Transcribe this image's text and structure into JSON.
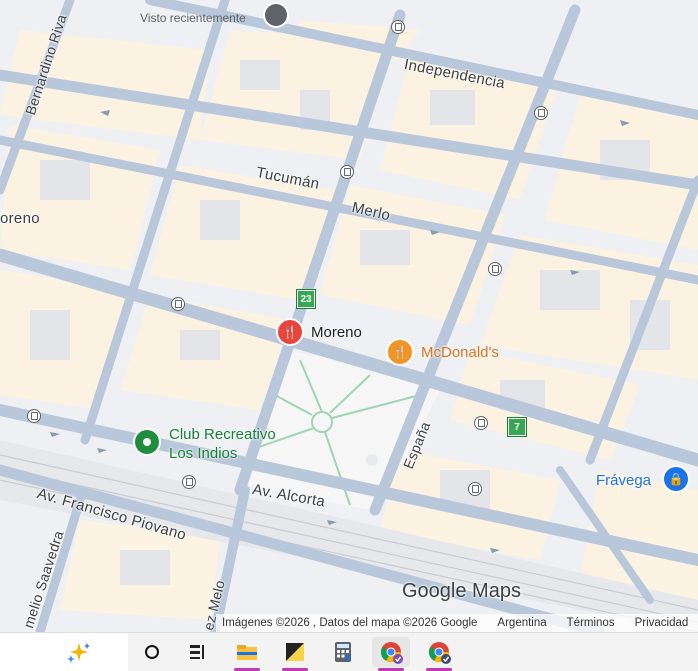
{
  "map": {
    "recent_label": "Visto recientemente",
    "streets": {
      "independencia": "Independencia",
      "tucuman": "Tucumán",
      "merlo": "Merlo",
      "bernardino": "Bernardino Riva",
      "moreno_left": "oreno",
      "espana": "España",
      "alcorta": "Av. Alcorta",
      "piovano": "Av. Francisco Piovano",
      "saavedra": "melio Saavedra",
      "melo": "ez Melo"
    },
    "pois": {
      "moreno": "Moreno",
      "mcdonalds": "McDonald's",
      "club_line1": "Club Recreativo",
      "club_line2": "Los Indios",
      "fravega": "Frávega"
    },
    "routes": {
      "r23": "23",
      "r7": "7"
    },
    "brand": "Google Maps",
    "attribution": {
      "imagery": "Imágenes ©2026 , Datos del mapa ©2026 Google",
      "country": "Argentina",
      "terms": "Términos",
      "privacy": "Privacidad"
    }
  },
  "colors": {
    "road": "#b8c7d9",
    "block": "#fdf3e0",
    "building": "#e8eaed",
    "park": "#f5f5f5",
    "poi_red": "#e8453c",
    "poi_orange": "#f29423",
    "poi_green": "#1e8e3e",
    "poi_blue": "#1a73e8"
  },
  "taskbar": {
    "icons": [
      "copilot-icon",
      "search-circle-icon",
      "task-view-icon",
      "file-explorer-icon",
      "sticky-notes-icon",
      "calculator-icon",
      "chrome-icon",
      "chrome-profile-icon"
    ]
  }
}
